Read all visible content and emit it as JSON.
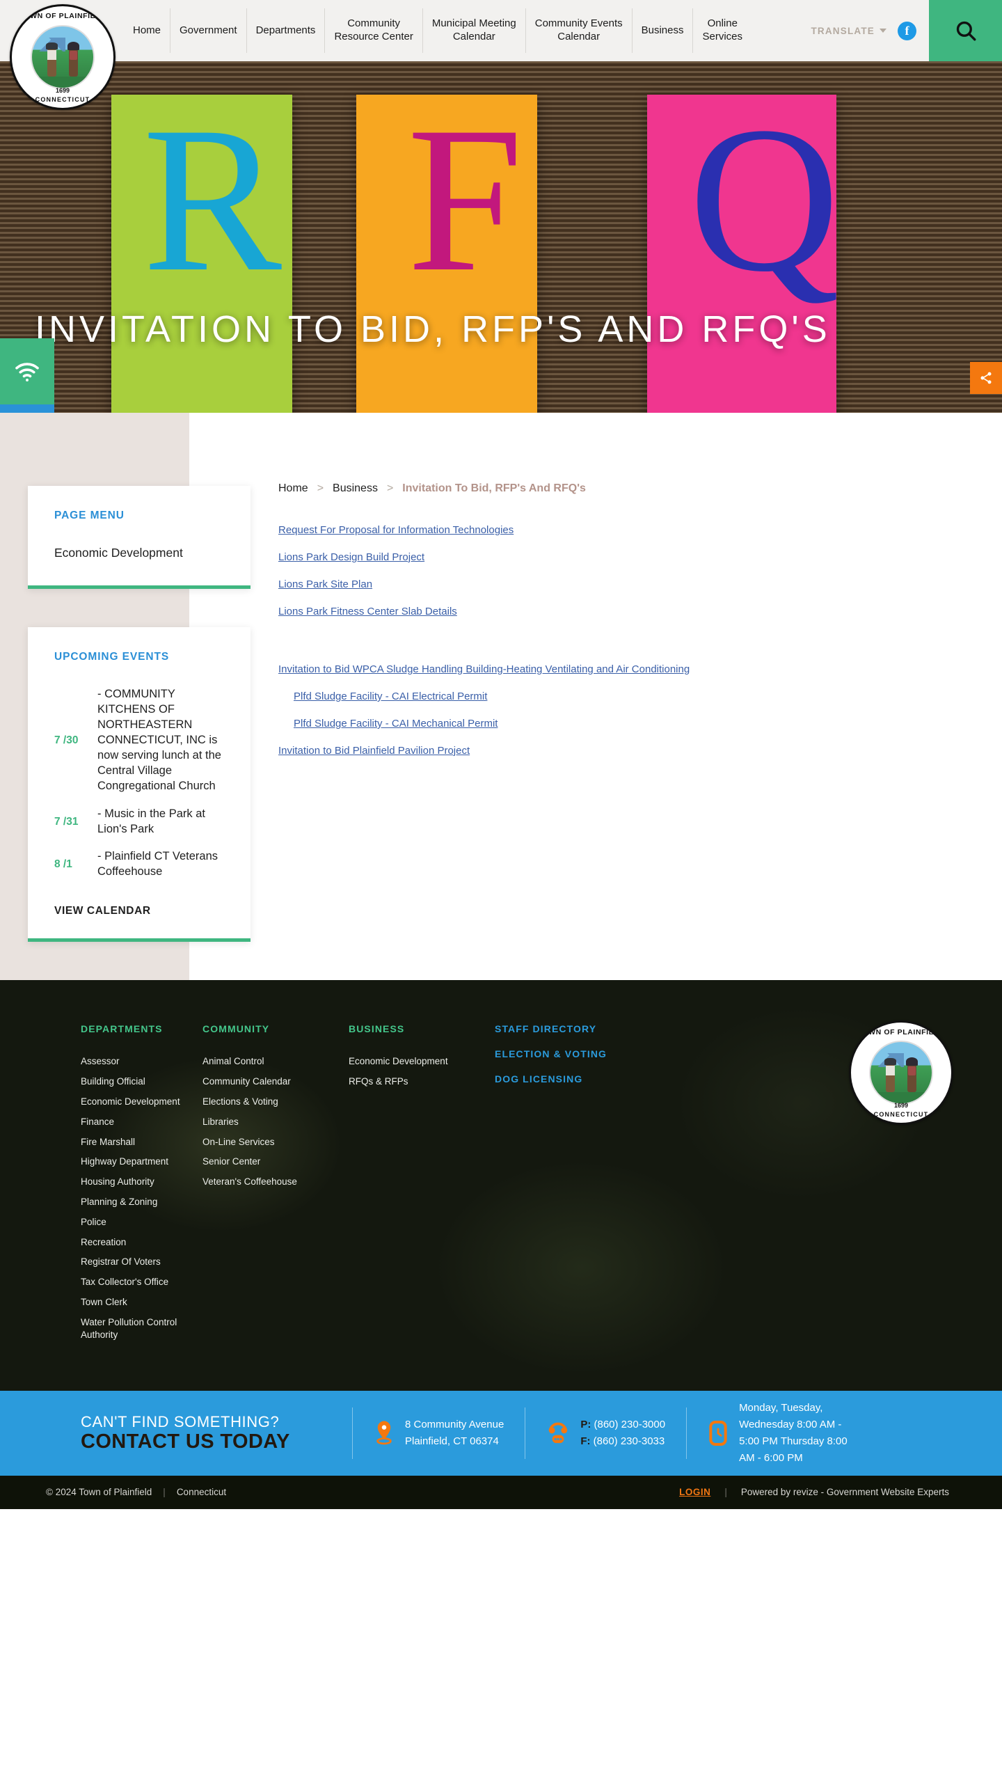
{
  "header": {
    "logo": {
      "top_text": "TOWN OF PLAINFIELD",
      "year": "1699",
      "state": "CONNECTICUT"
    },
    "nav": [
      {
        "label": "Home"
      },
      {
        "label": "Government"
      },
      {
        "label": "Departments"
      },
      {
        "label": "Community\nResource Center"
      },
      {
        "label": "Municipal Meeting\nCalendar"
      },
      {
        "label": "Community Events\nCalendar"
      },
      {
        "label": "Business"
      },
      {
        "label": "Online\nServices"
      }
    ],
    "translate_label": "TRANSLATE",
    "facebook_label": "f",
    "search_label": "Search"
  },
  "hero": {
    "title": "INVITATION TO BID, RFP'S AND RFQ'S",
    "notes": [
      "R",
      "F",
      "Q"
    ]
  },
  "rails": {
    "left": [
      {
        "name": "wifi-icon"
      },
      {
        "name": "waves-icon"
      },
      {
        "name": "award-icon"
      }
    ],
    "right": {
      "share": "share-icon",
      "accessibility": "accessibility-icon"
    }
  },
  "sidebar": {
    "page_menu": {
      "title": "PAGE MENU",
      "items": [
        {
          "label": "Economic Development"
        }
      ]
    },
    "upcoming_events": {
      "title": "UPCOMING EVENTS",
      "events": [
        {
          "date": "7 /30",
          "text": "- COMMUNITY KITCHENS OF NORTHEASTERN CONNECTICUT, INC is now serving lunch at the Central Village Congregational Church"
        },
        {
          "date": "7 /31",
          "text": "- Music in the Park at Lion's Park"
        },
        {
          "date": "8 /1",
          "text": "- Plainfield CT Veterans Coffeehouse"
        }
      ],
      "view_calendar": "VIEW CALENDAR"
    }
  },
  "breadcrumb": {
    "home": "Home",
    "sep": ">",
    "section": "Business",
    "current": "Invitation To Bid, RFP's And RFQ's"
  },
  "main": {
    "group1": [
      {
        "label": "Request For Proposal for Information Technologies",
        "indent": false
      },
      {
        "label": "Lions Park Design Build Project",
        "indent": false
      },
      {
        "label": "Lions Park Site Plan",
        "indent": false
      },
      {
        "label": "Lions Park Fitness Center Slab Details",
        "indent": false
      }
    ],
    "group2": [
      {
        "label": "Invitation to Bid WPCA Sludge Handling Building-Heating Ventilating and Air Conditioning",
        "indent": false
      },
      {
        "label": "Plfd Sludge Facility - CAI Electrical Permit",
        "indent": true
      },
      {
        "label": "Plfd Sludge Facility - CAI Mechanical Permit",
        "indent": true
      },
      {
        "label": "Invitation to Bid Plainfield Pavilion Project",
        "indent": false
      }
    ]
  },
  "footer": {
    "departments": {
      "title": "DEPARTMENTS",
      "items": [
        "Assessor",
        "Building Official",
        "Economic Development",
        "Finance",
        "Fire Marshall",
        "Highway Department",
        "Housing Authority",
        "Planning & Zoning",
        "Police",
        "Recreation",
        "Registrar Of Voters",
        "Tax Collector's Office",
        "Town Clerk",
        "Water Pollution Control Authority"
      ]
    },
    "community": {
      "title": "COMMUNITY",
      "items": [
        "Animal Control",
        "Community Calendar",
        "Elections & Voting",
        "Libraries",
        "On-Line Services",
        "Senior Center",
        "Veteran's Coffeehouse"
      ]
    },
    "business": {
      "title": "BUSINESS",
      "items": [
        "Economic Development",
        "RFQs & RFPs"
      ]
    },
    "quick_links": [
      "STAFF DIRECTORY",
      "ELECTION & VOTING",
      "DOG LICENSING"
    ]
  },
  "contact": {
    "eyebrow": "CAN'T FIND SOMETHING?",
    "headline": "CONTACT US TODAY",
    "address_line1": "8 Community Avenue",
    "address_line2": "Plainfield, CT 06374",
    "phone_label": "P:",
    "phone": "(860) 230-3000",
    "fax_label": "F:",
    "fax": "(860) 230-3033",
    "hours": "Monday, Tuesday, Wednesday 8:00 AM - 5:00 PM Thursday 8:00 AM - 6:00 PM"
  },
  "copyright": {
    "left": "© 2024 Town of Plainfield",
    "state": "Connecticut",
    "login": "LOGIN",
    "powered": "Powered by revize - Government Website Experts"
  },
  "colors": {
    "green": "#3fb680",
    "blue": "#2b9bdc",
    "orange": "#f4780f",
    "link": "#3a5fa8",
    "footer_heading": "#44c68b"
  }
}
